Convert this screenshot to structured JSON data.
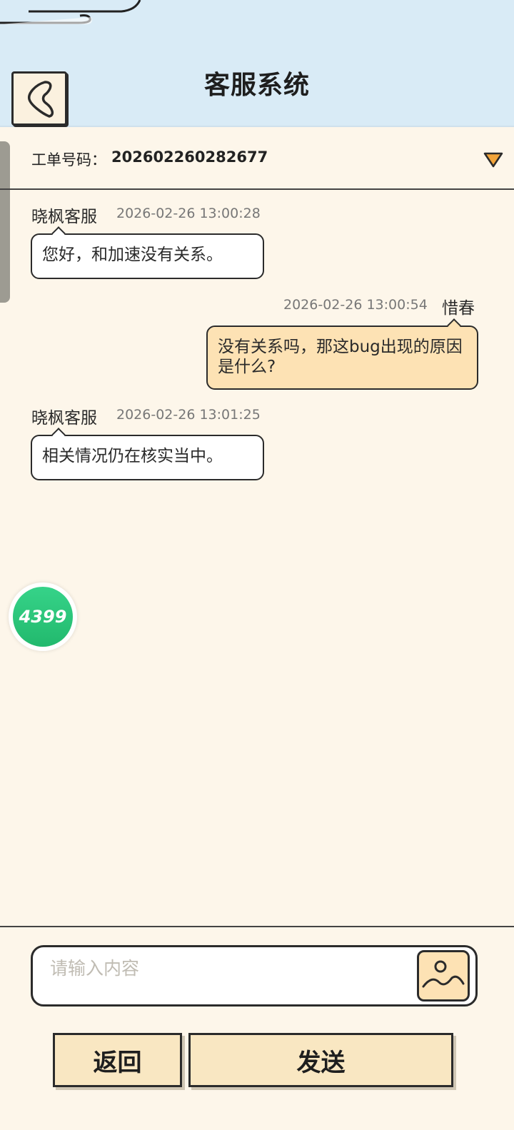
{
  "header": {
    "title": "客服系统"
  },
  "ticket": {
    "label": "工单号码：",
    "number": "202602260282677"
  },
  "messages": [
    {
      "side": "left",
      "name": "晓枫客服",
      "time": "2026-02-26 13:00:28",
      "text": "您好，和加速没有关系。"
    },
    {
      "side": "right",
      "name": "惜春",
      "time": "2026-02-26 13:00:54",
      "text": "没有关系吗，那这bug出现的原因是什么?"
    },
    {
      "side": "left",
      "name": "晓枫客服",
      "time": "2026-02-26 13:01:25",
      "text": "相关情况仍在核实当中。"
    }
  ],
  "badge": {
    "text": "4399"
  },
  "input": {
    "placeholder": "请输入内容"
  },
  "buttons": {
    "back_label": "返回",
    "send_label": "发送"
  },
  "colors": {
    "header_bg": "#d9ebf6",
    "page_bg": "#fdf6ea",
    "user_bubble": "#fde2b4",
    "button_bg": "#f9e7c2",
    "dropdown_accent": "#f2a43a",
    "badge_green": "#2cc67b"
  }
}
